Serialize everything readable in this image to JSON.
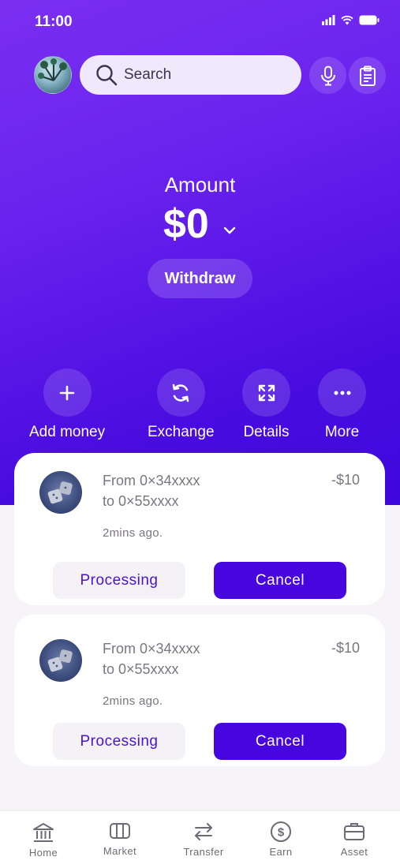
{
  "status": {
    "time": "11:00"
  },
  "search": {
    "placeholder": "Search"
  },
  "balance": {
    "label": "Amount",
    "value": "$0",
    "withdraw_label": "Withdraw"
  },
  "actions": [
    {
      "label": "Add money",
      "icon": "plus-icon"
    },
    {
      "label": "Exchange",
      "icon": "exchange-icon"
    },
    {
      "label": "Details",
      "icon": "expand-icon"
    },
    {
      "label": "More",
      "icon": "more-icon"
    }
  ],
  "transactions": [
    {
      "from": "From 0×34xxxx",
      "to": "to 0×55xxxx",
      "amount": "-$10",
      "time": "2mins ago.",
      "status_label": "Processing",
      "cancel_label": "Cancel"
    },
    {
      "from": "From 0×34xxxx",
      "to": "to 0×55xxxx",
      "amount": "-$10",
      "time": "2mins ago.",
      "status_label": "Processing",
      "cancel_label": "Cancel"
    }
  ],
  "nav": [
    {
      "label": "Home",
      "icon": "bank-icon"
    },
    {
      "label": "Market",
      "icon": "market-icon"
    },
    {
      "label": "Transfer",
      "icon": "transfer-icon"
    },
    {
      "label": "Earn",
      "icon": "dollar-icon"
    },
    {
      "label": "Asset",
      "icon": "briefcase-icon"
    }
  ],
  "colors": {
    "primary": "#4705e0",
    "hero_top": "#7a2ff0",
    "hero_bottom": "#3d08dc"
  }
}
